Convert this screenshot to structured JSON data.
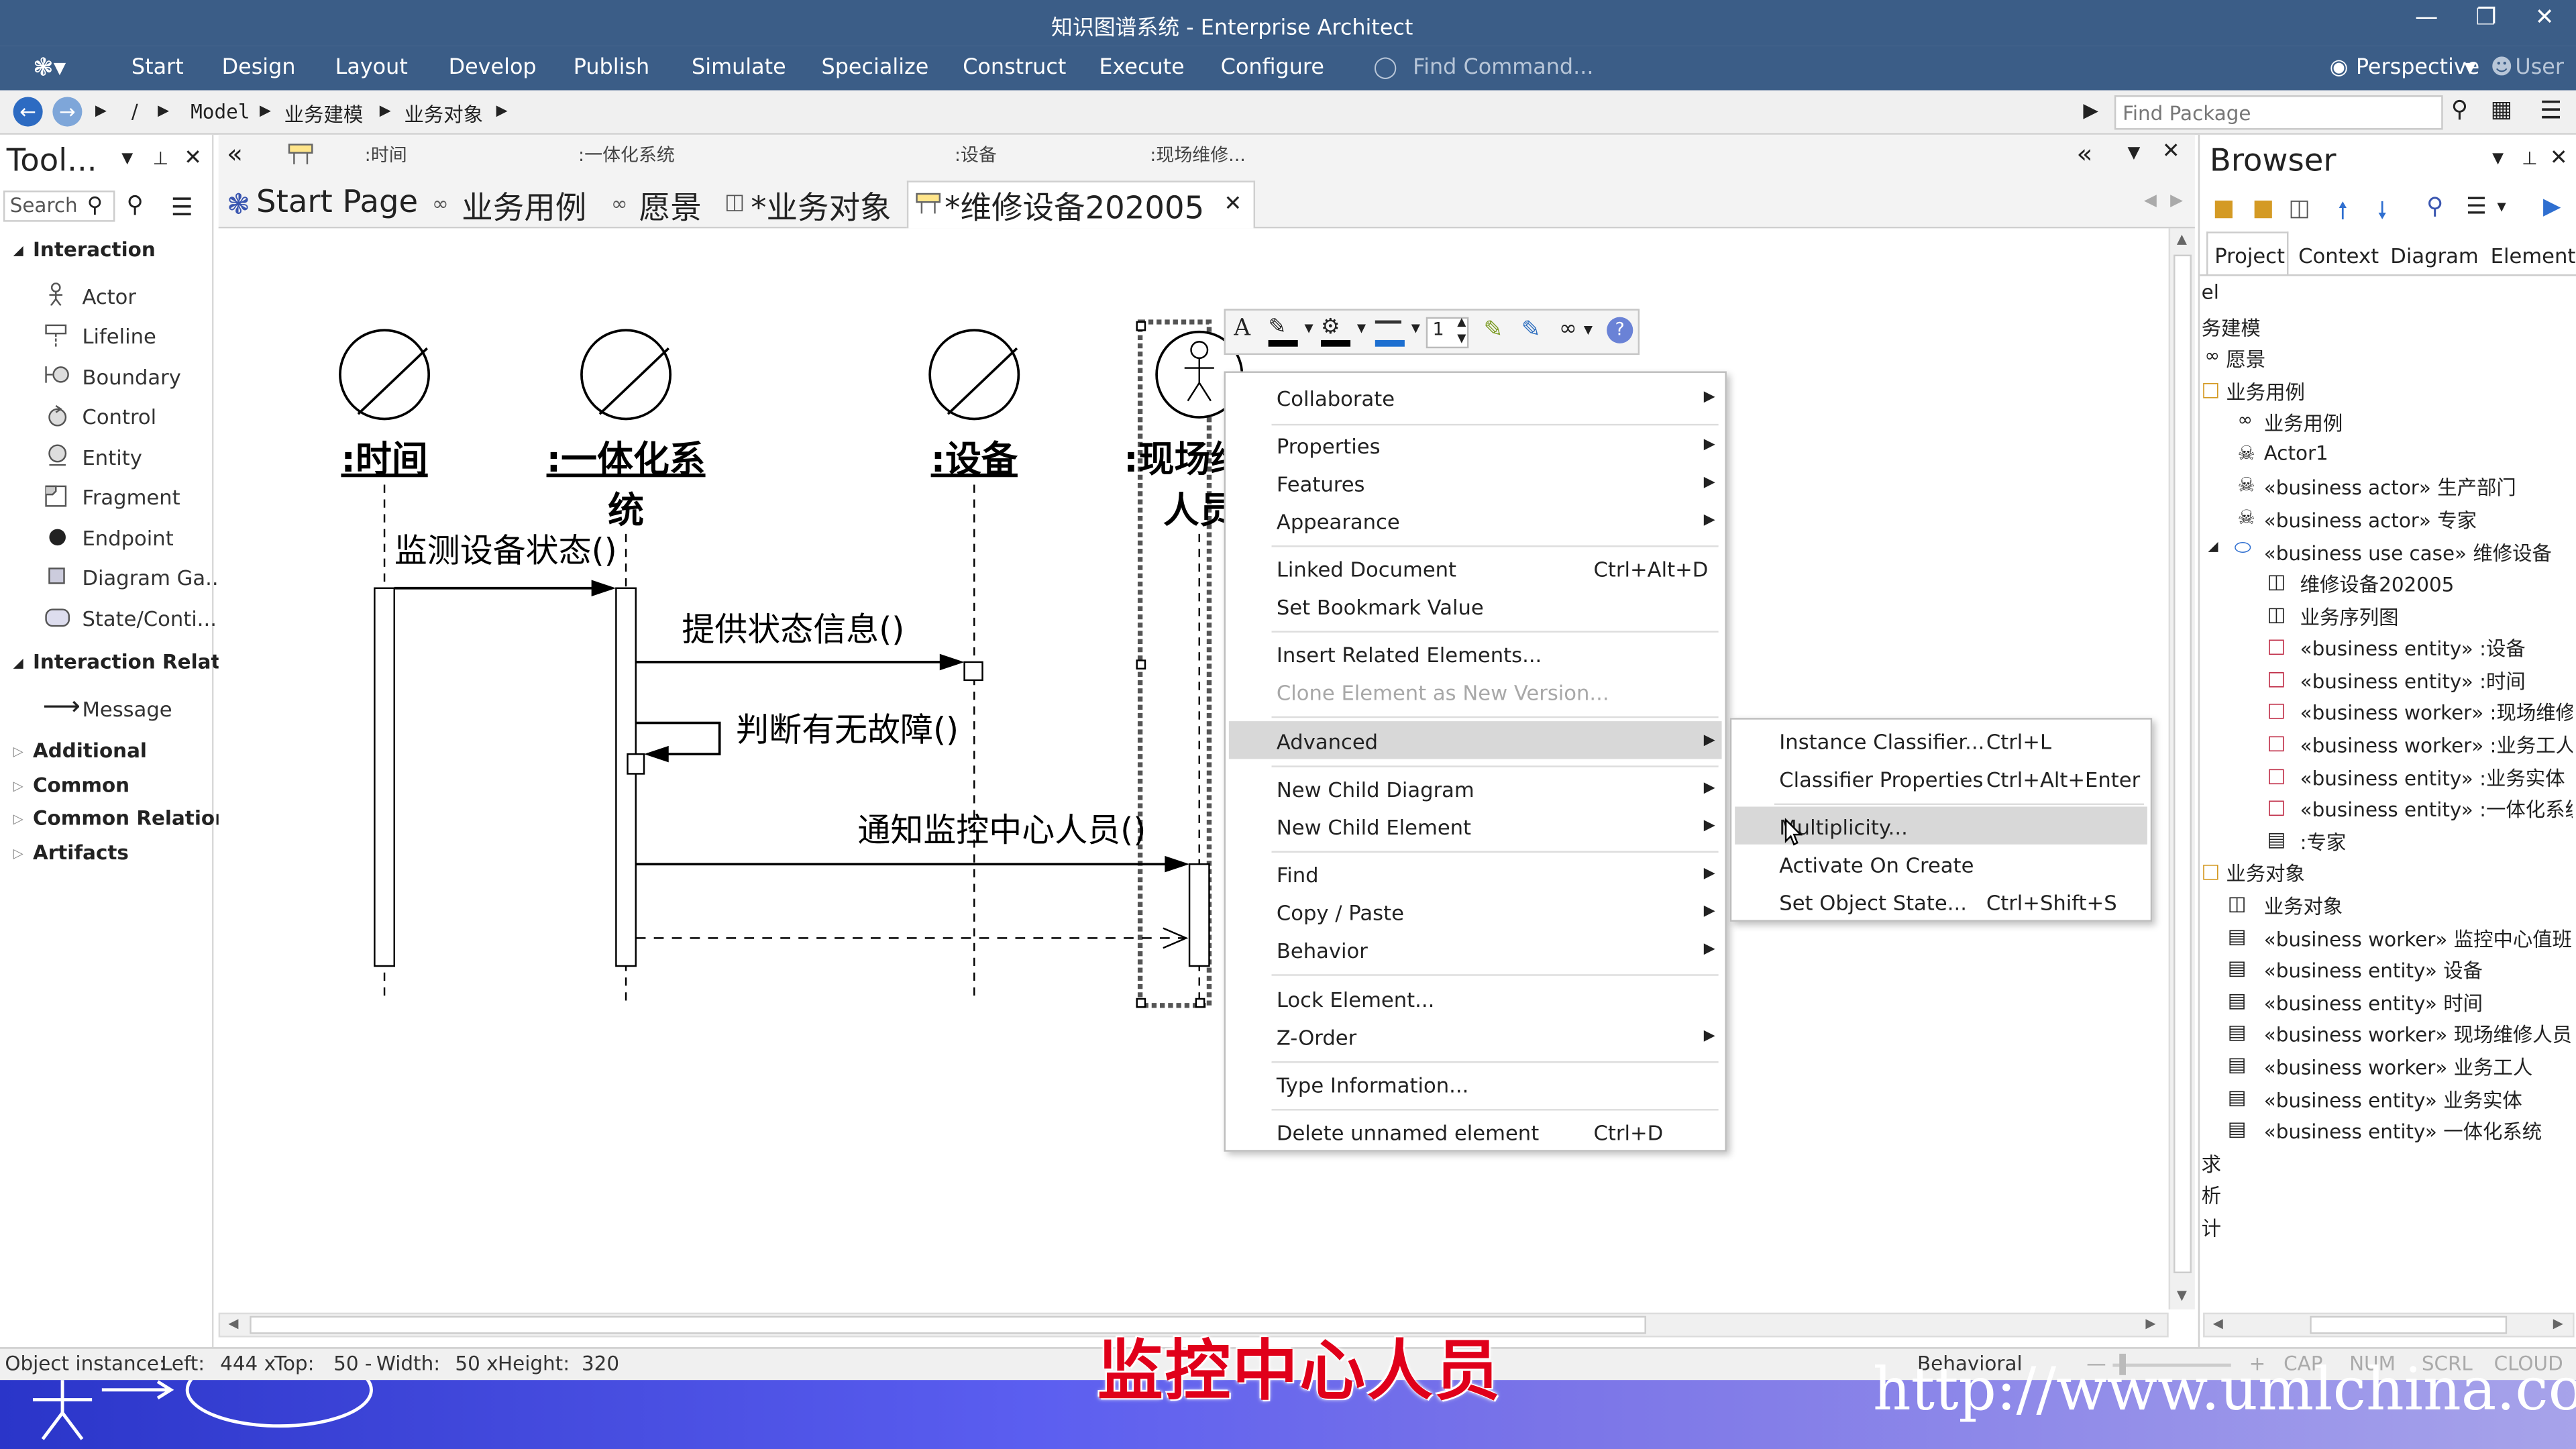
{
  "window": {
    "title": "知识图谱系统 - Enterprise Architect"
  },
  "menubar": {
    "items": [
      "Start",
      "Design",
      "Layout",
      "Develop",
      "Publish",
      "Simulate",
      "Specialize",
      "Construct",
      "Execute",
      "Configure"
    ],
    "find_command": "Find Command...",
    "perspective": "Perspective",
    "user": "User"
  },
  "address": {
    "breadcrumbs": [
      "Model",
      "业务建模",
      "业务对象"
    ],
    "slash": "/",
    "find_package_placeholder": "Find Package"
  },
  "toolbox": {
    "title": "Tool...",
    "search_placeholder": "Search",
    "groups": {
      "interaction": "Interaction",
      "interaction_relations": "Interaction Relatio",
      "additional": "Additional",
      "common": "Common",
      "common_relations": "Common Relations",
      "artifacts": "Artifacts"
    },
    "tools": [
      "Actor",
      "Lifeline",
      "Boundary",
      "Control",
      "Entity",
      "Fragment",
      "Endpoint",
      "Diagram Ga...",
      "State/Conti..."
    ],
    "relation_tools": [
      "Message"
    ]
  },
  "diagram_bar": {
    "items": [
      ":时间",
      ":一体化系统",
      ":设备",
      ":现场维修..."
    ]
  },
  "tabs": [
    "Start Page",
    "业务用例",
    "愿景",
    "*业务对象",
    "*维修设备202005"
  ],
  "diagram": {
    "lifelines": [
      ":时间",
      ":一体化系统",
      ":设备",
      ":现场维修人员"
    ],
    "lifeline_lines": {
      "一体化": [
        ":一体化系",
        "统"
      ],
      "现场": [
        ":现场维",
        "人员"
      ]
    },
    "messages": [
      "监测设备状态()",
      "提供状态信息()",
      "判断有无故障()",
      "通知监控中心人员()"
    ]
  },
  "format_toolbar": {
    "line_width": "1"
  },
  "context_menu": {
    "items": [
      {
        "label": "Collaborate",
        "submenu": true
      },
      {
        "label": "Properties",
        "submenu": true
      },
      {
        "label": "Features",
        "submenu": true
      },
      {
        "label": "Appearance",
        "submenu": true
      },
      {
        "label": "Linked Document",
        "shortcut": "Ctrl+Alt+D"
      },
      {
        "label": "Set Bookmark Value"
      },
      {
        "label": "Insert Related Elements..."
      },
      {
        "label": "Clone Element as New Version...",
        "disabled": true
      },
      {
        "label": "Advanced",
        "submenu": true,
        "highlighted": true
      },
      {
        "label": "New Child Diagram",
        "submenu": true
      },
      {
        "label": "New Child Element",
        "submenu": true
      },
      {
        "label": "Find",
        "submenu": true
      },
      {
        "label": "Copy / Paste",
        "submenu": true
      },
      {
        "label": "Behavior",
        "submenu": true
      },
      {
        "label": "Lock Element..."
      },
      {
        "label": "Z-Order",
        "submenu": true
      },
      {
        "label": "Type Information..."
      },
      {
        "label": "Delete unnamed element",
        "shortcut": "Ctrl+D"
      }
    ]
  },
  "submenu": {
    "items": [
      {
        "label": "Instance Classifier...",
        "shortcut": "Ctrl+L"
      },
      {
        "label": "Classifier Properties",
        "shortcut": "Ctrl+Alt+Enter"
      },
      {
        "label": "Multiplicity...",
        "highlighted": true
      },
      {
        "label": "Activate On Create"
      },
      {
        "label": "Set Object State...",
        "shortcut": "Ctrl+Shift+S"
      }
    ]
  },
  "browser": {
    "title": "Browser",
    "tabs": [
      "Project",
      "Context",
      "Diagram",
      "Element"
    ],
    "items": [
      "el",
      "务建模",
      "愿景",
      "业务用例",
      "业务用例",
      "Actor1",
      "«business actor» 生产部门",
      "«business actor» 专家",
      "«business use case» 维修设备",
      "维修设备202005",
      "业务序列图",
      "«business entity» :设备",
      "«business entity» :时间",
      "«business worker» :现场维修",
      "«business worker» :业务工人",
      "«business entity» :业务实体",
      "«business entity» :一体化系统",
      ":专家",
      "业务对象",
      "业务对象",
      "«business worker» 监控中心值班",
      "«business entity» 设备",
      "«business entity» 时间",
      "«business worker» 现场维修人员",
      "«business worker» 业务工人",
      "«business entity» 业务实体",
      "«business entity» 一体化系统",
      "求",
      "析",
      "计"
    ]
  },
  "status": {
    "object_instance": "Object instance:",
    "left_label": "Left:",
    "left": "444 x",
    "top_label": "Top:",
    "top": "50 -",
    "width_label": "Width:",
    "width": "50 x",
    "height_label": "Height:",
    "height": "320",
    "mode": "Behavioral",
    "indicators": [
      "CAP",
      "NUM",
      "SCRL",
      "CLOUD"
    ]
  },
  "caption": "监控中心人员",
  "watermark": "http://www.umlchina.com",
  "colors": {
    "titlebar": "#3b5d87",
    "highlight": "#d8d8d8",
    "caption": "#e0001a"
  }
}
